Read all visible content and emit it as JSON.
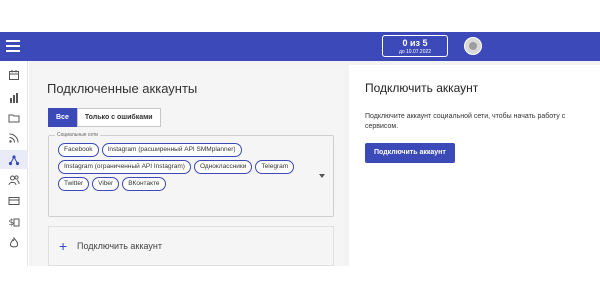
{
  "header": {
    "counter_main": "0 из 5",
    "counter_sub": "до 10.07.2022",
    "menu_icon": "menu-icon",
    "avatar_icon": "avatar-icon",
    "accent_color": "#3b4ab8"
  },
  "sidebar": {
    "items": [
      {
        "icon": "calendar-icon",
        "active": false
      },
      {
        "icon": "bar-chart-icon",
        "active": false
      },
      {
        "icon": "folder-icon",
        "active": false
      },
      {
        "icon": "rss-icon",
        "active": false
      },
      {
        "icon": "accounts-network-icon",
        "active": true
      },
      {
        "icon": "users-icon",
        "active": false
      },
      {
        "icon": "card-icon",
        "active": false
      },
      {
        "icon": "money-icon",
        "active": false
      },
      {
        "icon": "fire-icon",
        "active": false
      }
    ]
  },
  "left": {
    "title": "Подключенные аккаунты",
    "tabs": [
      "Все",
      "Только с ошибками"
    ],
    "filter_legend": "Социальные сети",
    "chips": [
      "Facebook",
      "Instagram (расширенный API SMMplanner)",
      "Instagram (ограниченный API Instagram)",
      "Одноклассники",
      "Telegram",
      "Twitter",
      "Viber",
      "ВКонтакте"
    ],
    "add_label": "Подключить аккаунт"
  },
  "right": {
    "title": "Подключить аккаунт",
    "description": "Подключите аккаунт социальной сети, чтобы начать работу с сервисом.",
    "button_label": "Подключить аккаунт"
  }
}
